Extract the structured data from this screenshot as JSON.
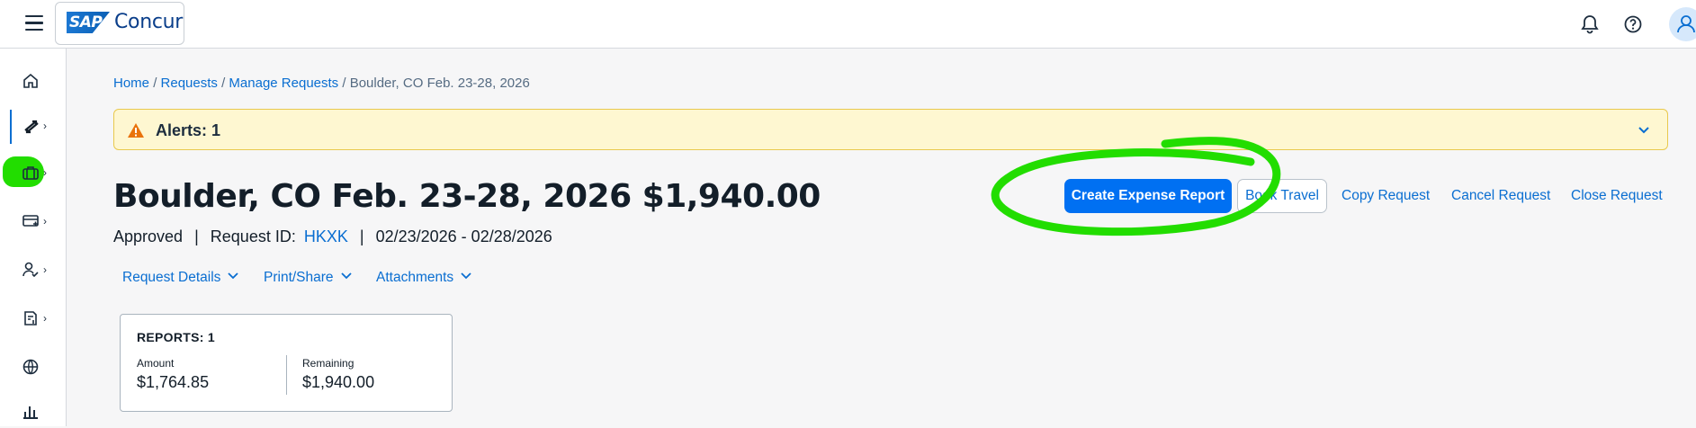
{
  "header": {
    "logo_mark": "SAP",
    "logo_text": "Concur",
    "icons": [
      "menu-icon",
      "bell-icon",
      "help-icon",
      "user-icon"
    ]
  },
  "sidebar": {
    "items": [
      {
        "icon": "home-icon"
      },
      {
        "icon": "requests-icon"
      },
      {
        "icon": "travel-briefcase-icon"
      },
      {
        "icon": "expense-card-icon"
      },
      {
        "icon": "approvals-user-icon"
      },
      {
        "icon": "invoice-icon"
      },
      {
        "icon": "globe-icon"
      },
      {
        "icon": "reporting-icon"
      }
    ]
  },
  "breadcrumb": {
    "items": [
      "Home",
      "Requests",
      "Manage Requests"
    ],
    "current": "Boulder, CO Feb. 23-28, 2026",
    "separator": "/"
  },
  "alert": {
    "label": "Alerts: 1",
    "color_bg": "#fef7d1",
    "color_icon": "#e9730c"
  },
  "request": {
    "title": "Boulder, CO Feb. 23-28, 2026 $1,940.00",
    "status": "Approved",
    "id_label": "Request ID:",
    "id_value": "HKXK",
    "dates": "02/23/2026 - 02/28/2026"
  },
  "actions": {
    "create_expense_report": "Create Expense Report",
    "book_travel": "Book Travel",
    "copy_request": "Copy Request",
    "cancel_request": "Cancel Request",
    "close_request": "Close Request",
    "primary_color": "#0070f2"
  },
  "tabs": [
    {
      "label": "Request Details"
    },
    {
      "label": "Print/Share"
    },
    {
      "label": "Attachments"
    }
  ],
  "reports_card": {
    "title": "REPORTS: 1",
    "amount_label": "Amount",
    "amount_value": "$1,764.85",
    "remaining_label": "Remaining",
    "remaining_value": "$1,940.00"
  },
  "annotation": {
    "highlight_color": "#22dd00"
  }
}
